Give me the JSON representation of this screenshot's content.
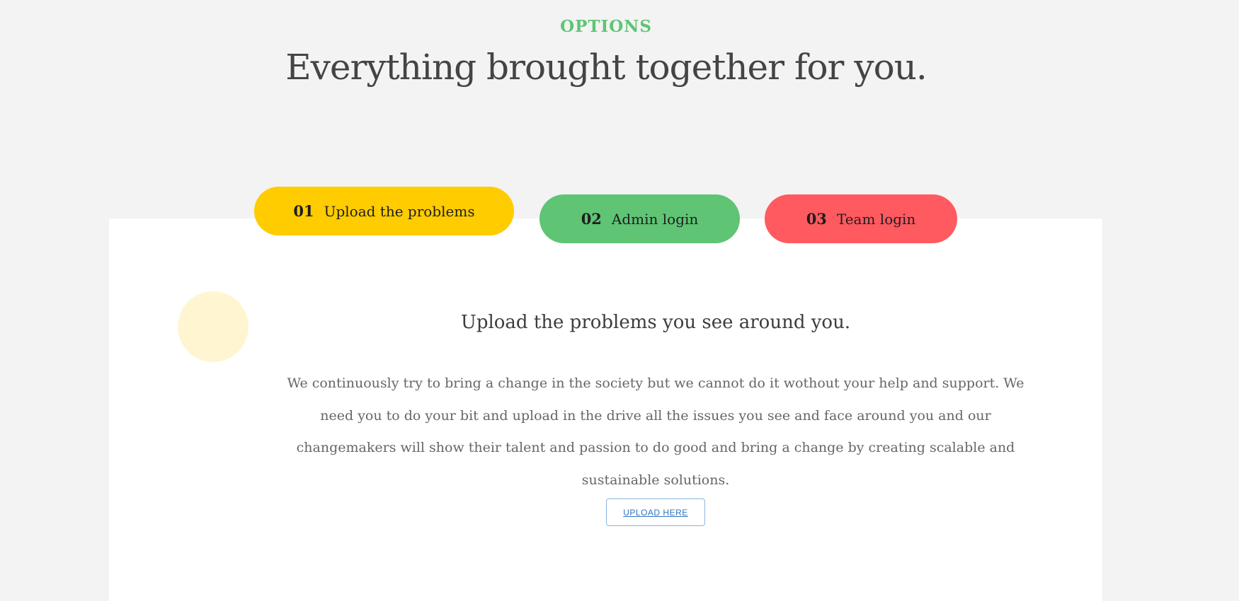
{
  "section": {
    "eyebrow": "OPTIONS",
    "headline": "Everything brought together for you."
  },
  "tabs": [
    {
      "number": "01",
      "label": "Upload the problems",
      "color": "#ffcc00",
      "active": true
    },
    {
      "number": "02",
      "label": "Admin login",
      "color": "#5fc474",
      "active": false
    },
    {
      "number": "03",
      "label": "Team login",
      "color": "#ff5a60",
      "active": false
    }
  ],
  "content": {
    "title": "Upload the problems you see around you.",
    "body": "We continuously try to bring a change in the society but we cannot do it wothout your help and support. We need you to do your bit and upload in the drive all the issues you see and face around you and our changemakers will show their talent and passion to do good and bring a change by creating scalable and sustainable solutions.",
    "button_label": "UPLOAD HERE"
  },
  "colors": {
    "accent_green": "#5fc474",
    "accent_yellow": "#ffcc00",
    "accent_red": "#ff5a60",
    "link_blue": "#2f74c0",
    "page_background": "#f3f3f3",
    "panel_background": "#ffffff"
  }
}
